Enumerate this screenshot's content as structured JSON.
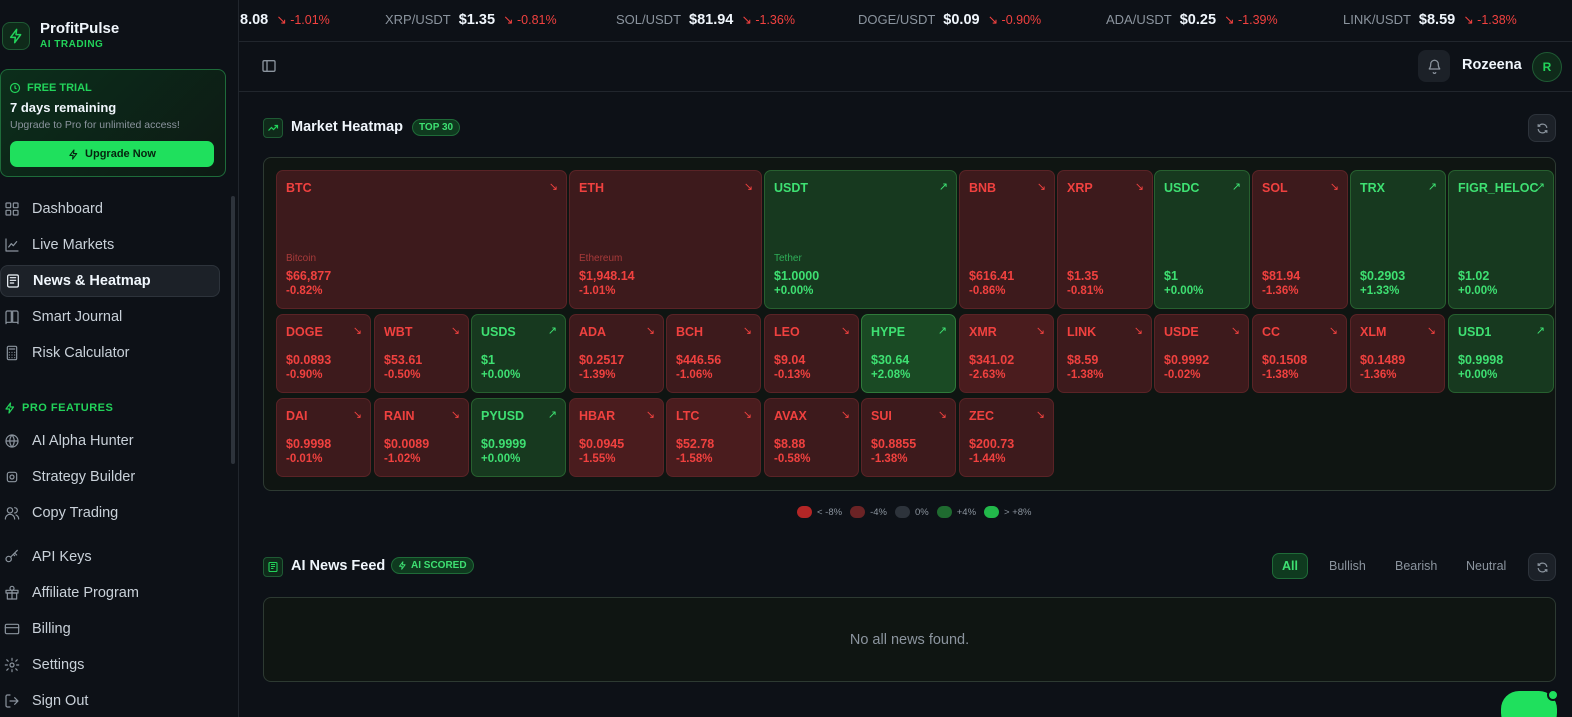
{
  "brand": {
    "name": "ProfitPulse",
    "sub": "AI TRADING"
  },
  "trial": {
    "badge": "FREE TRIAL",
    "days": "7 days remaining",
    "desc": "Upgrade to Pro for unlimited access!",
    "button": "Upgrade Now"
  },
  "nav": {
    "main": [
      {
        "label": "Dashboard",
        "icon": "dashboard-icon"
      },
      {
        "label": "Live Markets",
        "icon": "chart-line-icon"
      },
      {
        "label": "News & Heatmap",
        "icon": "newspaper-icon",
        "active": true
      },
      {
        "label": "Smart Journal",
        "icon": "book-icon"
      },
      {
        "label": "Risk Calculator",
        "icon": "calculator-icon"
      }
    ],
    "pro_label": "PRO FEATURES",
    "pro": [
      {
        "label": "AI Alpha Hunter",
        "icon": "globe-icon"
      },
      {
        "label": "Strategy Builder",
        "icon": "cog-icon"
      },
      {
        "label": "Copy Trading",
        "icon": "users-icon"
      }
    ],
    "bottom": [
      {
        "label": "API Keys",
        "icon": "key-icon"
      },
      {
        "label": "Affiliate Program",
        "icon": "gift-icon"
      },
      {
        "label": "Billing",
        "icon": "card-icon"
      },
      {
        "label": "Settings",
        "icon": "gear-icon"
      },
      {
        "label": "Sign Out",
        "icon": "logout-icon"
      }
    ]
  },
  "ticker": [
    {
      "symbol": "",
      "price": "8.08",
      "change": "-1.01%"
    },
    {
      "symbol": "XRP/USDT",
      "price": "$1.35",
      "change": "-0.81%"
    },
    {
      "symbol": "SOL/USDT",
      "price": "$81.94",
      "change": "-1.36%"
    },
    {
      "symbol": "DOGE/USDT",
      "price": "$0.09",
      "change": "-0.90%"
    },
    {
      "symbol": "ADA/USDT",
      "price": "$0.25",
      "change": "-1.39%"
    },
    {
      "symbol": "LINK/USDT",
      "price": "$8.59",
      "change": "-1.38%"
    }
  ],
  "header": {
    "username": "Rozeena",
    "avatar": "R"
  },
  "heatmap": {
    "title": "Market Heatmap",
    "badge": "TOP 30",
    "tiles": [
      {
        "sym": "BTC",
        "name": "Bitcoin",
        "price": "$66,877",
        "change": "-0.82%",
        "dir": "neg"
      },
      {
        "sym": "ETH",
        "name": "Ethereum",
        "price": "$1,948.14",
        "change": "-1.01%",
        "dir": "neg"
      },
      {
        "sym": "USDT",
        "name": "Tether",
        "price": "$1.0000",
        "change": "+0.00%",
        "dir": "pos"
      },
      {
        "sym": "BNB",
        "name": "",
        "price": "$616.41",
        "change": "-0.86%",
        "dir": "neg"
      },
      {
        "sym": "XRP",
        "name": "",
        "price": "$1.35",
        "change": "-0.81%",
        "dir": "neg"
      },
      {
        "sym": "USDC",
        "name": "",
        "price": "$1",
        "change": "+0.00%",
        "dir": "pos"
      },
      {
        "sym": "SOL",
        "name": "",
        "price": "$81.94",
        "change": "-1.36%",
        "dir": "neg"
      },
      {
        "sym": "TRX",
        "name": "",
        "price": "$0.2903",
        "change": "+1.33%",
        "dir": "pos"
      },
      {
        "sym": "FIGR_HELOC",
        "name": "",
        "price": "$1.02",
        "change": "+0.00%",
        "dir": "pos"
      },
      {
        "sym": "DOGE",
        "name": "",
        "price": "$0.0893",
        "change": "-0.90%",
        "dir": "neg"
      },
      {
        "sym": "WBT",
        "name": "",
        "price": "$53.61",
        "change": "-0.50%",
        "dir": "neg"
      },
      {
        "sym": "USDS",
        "name": "",
        "price": "$1",
        "change": "+0.00%",
        "dir": "pos"
      },
      {
        "sym": "ADA",
        "name": "",
        "price": "$0.2517",
        "change": "-1.39%",
        "dir": "neg"
      },
      {
        "sym": "BCH",
        "name": "",
        "price": "$446.56",
        "change": "-1.06%",
        "dir": "neg"
      },
      {
        "sym": "LEO",
        "name": "",
        "price": "$9.04",
        "change": "-0.13%",
        "dir": "neg"
      },
      {
        "sym": "HYPE",
        "name": "",
        "price": "$30.64",
        "change": "+2.08%",
        "dir": "pos"
      },
      {
        "sym": "XMR",
        "name": "",
        "price": "$341.02",
        "change": "-2.63%",
        "dir": "neg"
      },
      {
        "sym": "LINK",
        "name": "",
        "price": "$8.59",
        "change": "-1.38%",
        "dir": "neg"
      },
      {
        "sym": "USDE",
        "name": "",
        "price": "$0.9992",
        "change": "-0.02%",
        "dir": "neg"
      },
      {
        "sym": "CC",
        "name": "",
        "price": "$0.1508",
        "change": "-1.38%",
        "dir": "neg"
      },
      {
        "sym": "XLM",
        "name": "",
        "price": "$0.1489",
        "change": "-1.36%",
        "dir": "neg"
      },
      {
        "sym": "USD1",
        "name": "",
        "price": "$0.9998",
        "change": "+0.00%",
        "dir": "pos"
      },
      {
        "sym": "DAI",
        "name": "",
        "price": "$0.9998",
        "change": "-0.01%",
        "dir": "neg"
      },
      {
        "sym": "RAIN",
        "name": "",
        "price": "$0.0089",
        "change": "-1.02%",
        "dir": "neg"
      },
      {
        "sym": "PYUSD",
        "name": "",
        "price": "$0.9999",
        "change": "+0.00%",
        "dir": "pos"
      },
      {
        "sym": "HBAR",
        "name": "",
        "price": "$0.0945",
        "change": "-1.55%",
        "dir": "neg"
      },
      {
        "sym": "LTC",
        "name": "",
        "price": "$52.78",
        "change": "-1.58%",
        "dir": "neg"
      },
      {
        "sym": "AVAX",
        "name": "",
        "price": "$8.88",
        "change": "-0.58%",
        "dir": "neg"
      },
      {
        "sym": "SUI",
        "name": "",
        "price": "$0.8855",
        "change": "-1.38%",
        "dir": "neg"
      },
      {
        "sym": "ZEC",
        "name": "",
        "price": "$200.73",
        "change": "-1.44%",
        "dir": "neg"
      }
    ],
    "legend": [
      {
        "label": "< -8%",
        "color": "#b42626"
      },
      {
        "label": "-4%",
        "color": "#6b2325"
      },
      {
        "label": "0%",
        "color": "#2d333b"
      },
      {
        "label": "+4%",
        "color": "#1f6b30"
      },
      {
        "label": "> +8%",
        "color": "#22b84a"
      }
    ]
  },
  "news": {
    "title": "AI News Feed",
    "badge": "AI SCORED",
    "filters": [
      "All",
      "Bullish",
      "Bearish",
      "Neutral"
    ],
    "active_filter": "All",
    "empty": "No all news found."
  },
  "colors": {
    "accent": "#22d35a",
    "negative": "#f0413f",
    "positive": "#3ee072"
  }
}
